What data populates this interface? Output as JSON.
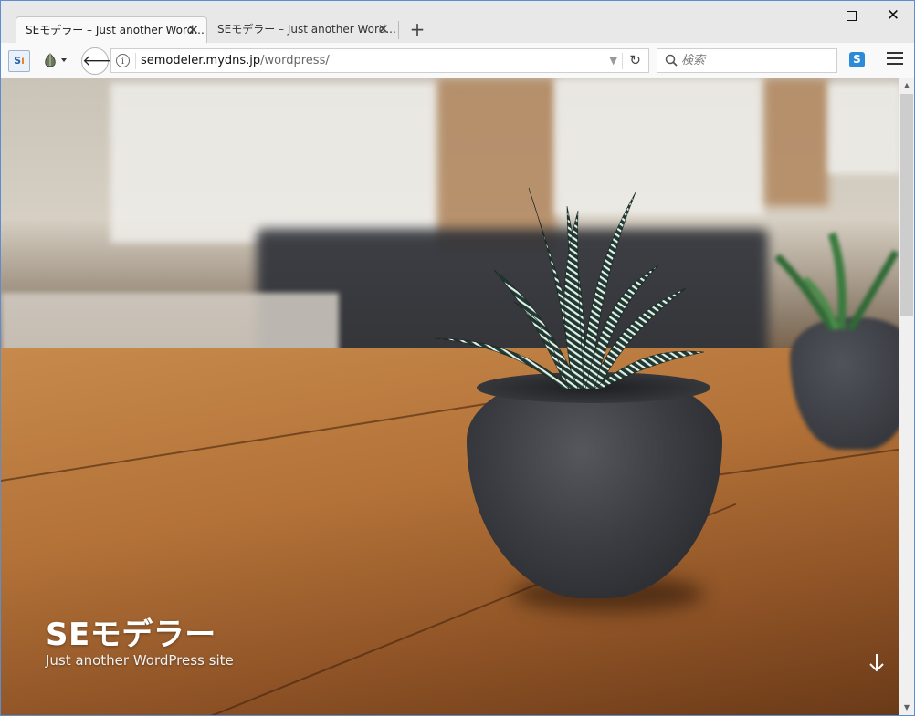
{
  "tabs": [
    {
      "title": "SEモデラー – Just another Word...",
      "active": true
    },
    {
      "title": "SEモデラー – Just another Word...",
      "active": false
    }
  ],
  "tab_close_glyph": "✕",
  "new_tab_glyph": "+",
  "window_controls": {
    "close_glyph": "✕"
  },
  "toolbar": {
    "ext_si_label_a": "S",
    "ext_si_label_b": "i",
    "back_glyph": "🡐",
    "url_host": "semodeler.mydns.jp",
    "url_path": "/wordpress/",
    "url_dropdown_glyph": "▼",
    "reload_glyph": "↻",
    "search_placeholder": "検索",
    "ext_s_label": "S"
  },
  "icons": {
    "si_extension": "si-extension-icon",
    "garlic_extension": "garlic-extension-icon",
    "back": "back-arrow-icon",
    "info": "info-icon",
    "search": "search-icon",
    "menu": "hamburger-menu-icon",
    "scroll_down": "arrow-down-icon"
  },
  "page": {
    "site_title": "SEモデラー",
    "site_tagline": "Just another WordPress site"
  },
  "colors": {
    "title_text": "#ffffff",
    "window_border": "#5a8ed1",
    "ext_s_badge": "#2d8ad8"
  }
}
